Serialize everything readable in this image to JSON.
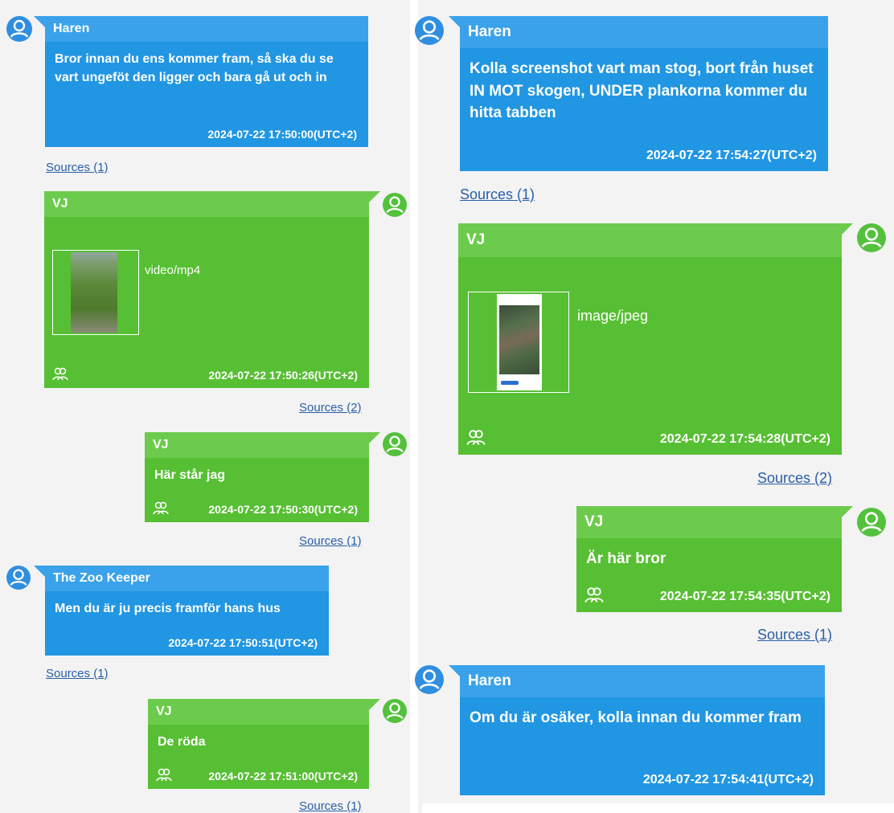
{
  "left": {
    "msg1": {
      "sender": "Haren",
      "text": "Bror innan du ens kommer fram, så ska du se vart ungeföt den ligger och bara gå ut och in",
      "time": "2024-07-22 17:50:00(UTC+2)",
      "sources": "Sources (1)"
    },
    "msg2": {
      "sender": "VJ",
      "attachment_type": "video/mp4",
      "time": "2024-07-22 17:50:26(UTC+2)",
      "sources": "Sources (2)"
    },
    "msg3": {
      "sender": "VJ",
      "text": "Här står jag",
      "time": "2024-07-22 17:50:30(UTC+2)",
      "sources": "Sources (1)"
    },
    "msg4": {
      "sender": "The Zoo Keeper",
      "text": "Men du är ju precis framför hans hus",
      "time": "2024-07-22 17:50:51(UTC+2)",
      "sources": "Sources (1)"
    },
    "msg5": {
      "sender": "VJ",
      "text": "De röda",
      "time": "2024-07-22 17:51:00(UTC+2)",
      "sources": "Sources (1)"
    }
  },
  "right": {
    "msg1": {
      "sender": "Haren",
      "text": "Kolla screenshot vart man stog, bort från huset IN MOT skogen, UNDER plankorna kommer du hitta tabben",
      "time": "2024-07-22 17:54:27(UTC+2)",
      "sources": "Sources (1)"
    },
    "msg2": {
      "sender": "VJ",
      "attachment_type": "image/jpeg",
      "time": "2024-07-22 17:54:28(UTC+2)",
      "sources": "Sources (2)"
    },
    "msg3": {
      "sender": "VJ",
      "text": "Är här bror",
      "time": "2024-07-22 17:54:35(UTC+2)",
      "sources": "Sources (1)"
    },
    "msg4": {
      "sender": "Haren",
      "text": "Om du är osäker, kolla innan du kommer fram",
      "time": "2024-07-22 17:54:41(UTC+2)"
    }
  },
  "colors": {
    "incoming": "#2196e3",
    "outgoing": "#57bf33",
    "link": "#2a5ea8"
  },
  "icons": {
    "sender_avatar": "person-icon",
    "group": "group-icon"
  }
}
